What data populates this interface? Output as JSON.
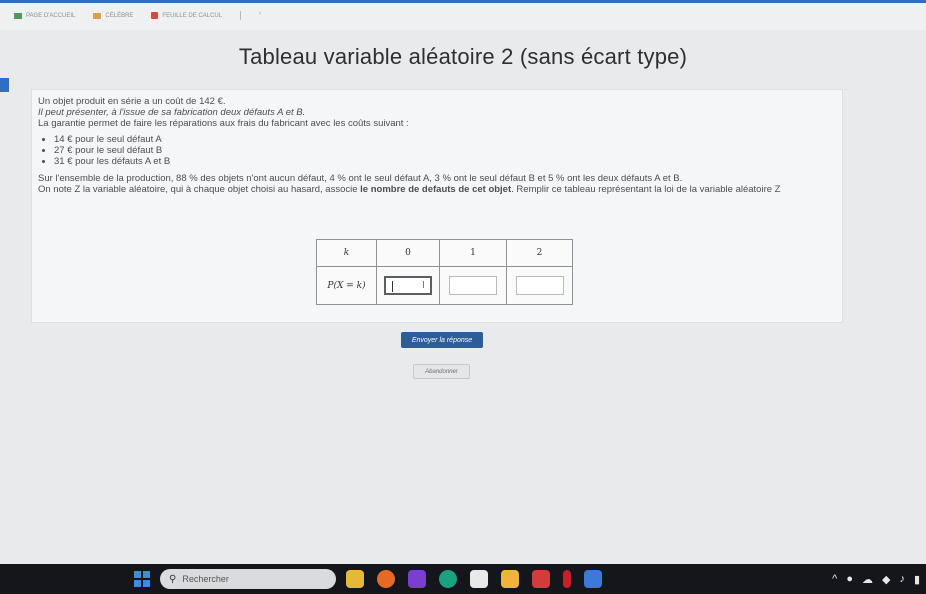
{
  "browser": {
    "bookmarks": [
      {
        "label": "PAGE D'ACCUEIL",
        "icon": "green-page-icon"
      },
      {
        "label": "CÉLÈBRE",
        "icon": "folder-icon"
      },
      {
        "label": "FEUILLE DE CALCUL",
        "icon": "sheet-icon"
      }
    ],
    "bookmark_more": "›"
  },
  "exercise": {
    "title": "Tableau variable aléatoire 2 (sans écart type)",
    "intro_1": "Un objet produit en série a un coût de 142 €.",
    "intro_2": "Il peut présenter, à l'issue de sa fabrication deux défauts A et B.",
    "intro_3": "La garantie permet de faire les réparations aux frais du fabricant avec les coûts suivant :",
    "costs": [
      "14 € pour le seul défaut A",
      "27 € pour le seul défaut B",
      "31 € pour les défauts A et B"
    ],
    "stats": "Sur l'ensemble de la production, 88 % des objets n'ont aucun défaut, 4 % ont le seul défaut A, 3 % ont le seul défaut B et 5 % ont les deux défauts A et B.",
    "question_start": "On note Z la variable aléatoire, qui à chaque objet choisi au hasard, associe ",
    "question_bold": "le nombre de defauts de cet objet",
    "question_end": ". Remplir ce tableau représentant la loi de la variable aléatoire Z",
    "table": {
      "header_label": "k",
      "values": [
        "0",
        "1",
        "2"
      ],
      "row_label": "P(X = k)",
      "answers": [
        "",
        "",
        ""
      ]
    }
  },
  "actions": {
    "submit_label": "Envoyer la réponse",
    "give_up_label": "Abandonner"
  },
  "taskbar": {
    "search_placeholder": "Rechercher",
    "apps": [
      {
        "name": "file-explorer-icon",
        "color": "#e8b73a"
      },
      {
        "name": "firefox-icon",
        "color": "#e66a25"
      },
      {
        "name": "purple-heart-app-icon",
        "color": "#7a3fd0"
      },
      {
        "name": "edge-icon",
        "color": "#1aa17f"
      },
      {
        "name": "store-icon",
        "color": "#e9e9e9"
      },
      {
        "name": "files-icon",
        "color": "#f0b43a"
      },
      {
        "name": "photo-app-icon",
        "color": "#d23c3c"
      },
      {
        "name": "red-app-icon",
        "color": "#c8202b"
      },
      {
        "name": "chrome-style-icon",
        "color": "#3b7ad9"
      }
    ]
  }
}
